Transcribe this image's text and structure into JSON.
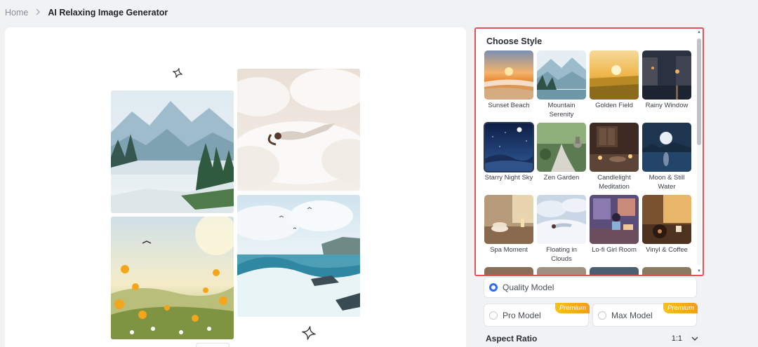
{
  "breadcrumb": {
    "home": "Home",
    "separator": ">",
    "current": "AI Relaxing Image Generator"
  },
  "choose_style": {
    "title": "Choose Style",
    "selected": "Starry Night Sky",
    "styles": [
      {
        "label": "Sunset Beach",
        "icon": "sunset-beach-thumbnail"
      },
      {
        "label": "Mountain Serenity",
        "icon": "mountain-serenity-thumbnail"
      },
      {
        "label": "Golden Field",
        "icon": "golden-field-thumbnail"
      },
      {
        "label": "Rainy Window",
        "icon": "rainy-window-thumbnail"
      },
      {
        "label": "Starry Night Sky",
        "icon": "starry-night-thumbnail"
      },
      {
        "label": "Zen Garden",
        "icon": "zen-garden-thumbnail"
      },
      {
        "label": "Candlelight Meditation",
        "icon": "candlelight-thumbnail"
      },
      {
        "label": "Moon & Still Water",
        "icon": "moon-water-thumbnail"
      },
      {
        "label": "Spa Moment",
        "icon": "spa-thumbnail"
      },
      {
        "label": "Floating in Clouds",
        "icon": "floating-clouds-thumbnail"
      },
      {
        "label": "Lo-fi Girl Room",
        "icon": "lofi-room-thumbnail"
      },
      {
        "label": "Vinyl & Coffee",
        "icon": "vinyl-coffee-thumbnail"
      }
    ]
  },
  "models": {
    "quality": {
      "label": "Quality Model",
      "selected": true
    },
    "pro": {
      "label": "Pro Model",
      "badge": "Premium"
    },
    "max": {
      "label": "Max Model",
      "badge": "Premium"
    }
  },
  "aspect_ratio": {
    "label": "Aspect Ratio",
    "value": "1:1"
  },
  "colors": {
    "highlight_border": "#e8505b",
    "radio_accent": "#2f6df5",
    "premium_badge": "#f5a91a"
  }
}
